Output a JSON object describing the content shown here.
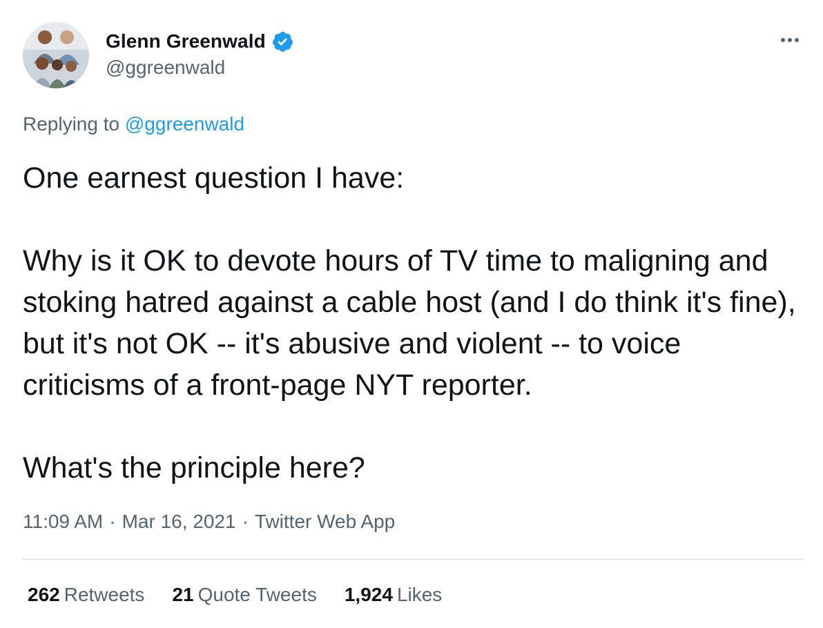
{
  "author": {
    "display_name": "Glenn Greenwald",
    "handle": "@ggreenwald",
    "verified": true,
    "verified_color": "#1d9bf0"
  },
  "more_icon": "more-horizontal-icon",
  "reply": {
    "prefix": "Replying to",
    "mention": "@ggreenwald"
  },
  "tweet": {
    "text": "One earnest question I have:\n\nWhy is it OK to devote hours of TV time to maligning and stoking hatred against a cable host (and I do think it's fine), but it's not OK -- it's abusive and violent -- to voice criticisms of a front-page NYT reporter.\n\nWhat's the principle here?"
  },
  "meta": {
    "time": "11:09 AM",
    "separator": "·",
    "date": "Mar 16, 2021",
    "source": "Twitter Web App"
  },
  "stats": {
    "retweets_count": "262",
    "retweets_label": "Retweets",
    "quotes_count": "21",
    "quotes_label": "Quote Tweets",
    "likes_count": "1,924",
    "likes_label": "Likes"
  },
  "colors": {
    "text": "#0f1419",
    "secondary": "#536471",
    "link": "#1d9bf0",
    "divider": "#cfd9de"
  }
}
